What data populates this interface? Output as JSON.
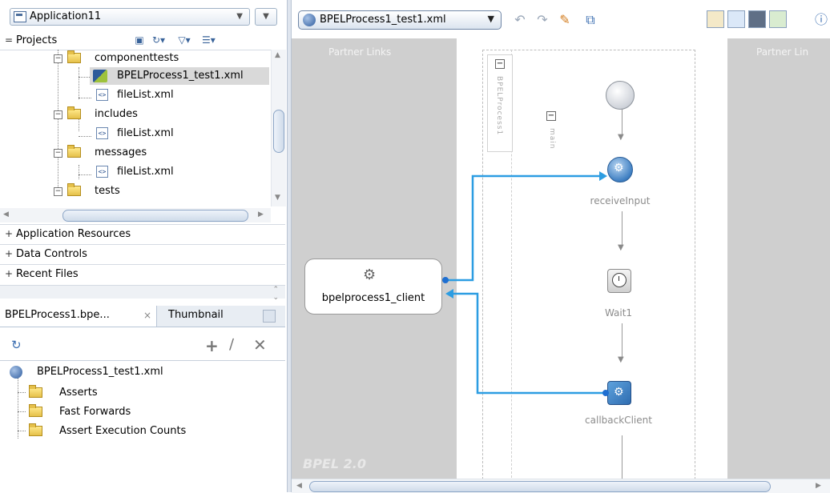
{
  "left_panel": {
    "application_selector": {
      "value": "Application11"
    },
    "projects_section": {
      "toggle": "=",
      "label": "Projects"
    },
    "tree_items": [
      {
        "label": "componenttests",
        "type": "folder",
        "expanded": true
      },
      {
        "label": "BPELProcess1_test1.xml",
        "type": "bpel-test-file",
        "selected": true
      },
      {
        "label": "fileList.xml",
        "type": "xml-file"
      },
      {
        "label": "includes",
        "type": "folder",
        "expanded": true
      },
      {
        "label": "fileList.xml",
        "type": "xml-file"
      },
      {
        "label": "messages",
        "type": "folder",
        "expanded": true
      },
      {
        "label": "fileList.xml",
        "type": "xml-file"
      },
      {
        "label": "tests",
        "type": "folder",
        "expanded": true
      }
    ],
    "accordion_sections": [
      {
        "toggle": "+",
        "label": "Application Resources"
      },
      {
        "toggle": "+",
        "label": "Data Controls"
      },
      {
        "toggle": "+",
        "label": "Recent Files"
      }
    ],
    "bottom_tabs": {
      "structure_tab": "BPELProcess1.bpe...",
      "thumbnail_tab": "Thumbnail",
      "close_glyph": "×"
    },
    "structure_tree": {
      "root": "BPELProcess1_test1.xml",
      "children": [
        "Asserts",
        "Fast Forwards",
        "Assert Execution Counts"
      ]
    }
  },
  "editor": {
    "test_selector": {
      "value": "BPELProcess1_test1.xml"
    },
    "canvas": {
      "partner_links_left_label": "Partner Links",
      "partner_links_right_label": "Partner Lin",
      "process_label": "BPELProcess1",
      "sequence_label": "main",
      "collapse_glyph": "−",
      "partner_link": {
        "label": "bpelprocess1_client"
      },
      "activities": [
        {
          "label": "receiveInput",
          "type": "receive"
        },
        {
          "label": "Wait1",
          "type": "wait"
        },
        {
          "label": "callbackClient",
          "type": "invoke"
        }
      ],
      "bpel_version": "BPEL 2.0"
    }
  },
  "colors": {
    "link": "#2c9de2",
    "partner_lane": "#cfcfcf",
    "selection": "#d9d9d9",
    "activity_label": "#8c8c8c"
  }
}
